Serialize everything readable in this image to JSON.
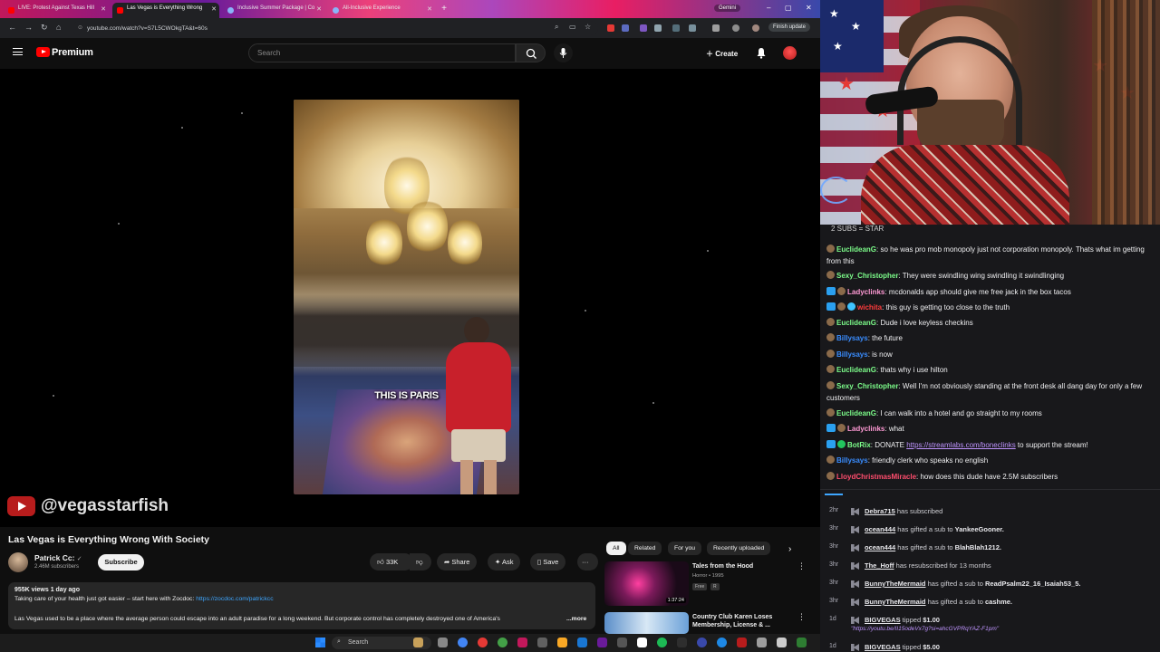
{
  "colors": {
    "yt_red": "#ff0000",
    "link_blue": "#3ea6ff",
    "twitch_purple": "#bf94ff"
  },
  "browser": {
    "tabs": [
      {
        "title": "LIVE: Protest Against Texas Hill",
        "favicon": "youtube-icon"
      },
      {
        "title": "Las Vegas is Everything Wrong",
        "favicon": "youtube-icon",
        "active": true
      },
      {
        "title": "Inclusive Summer Package | Co",
        "favicon": "globe-icon"
      },
      {
        "title": "All-Inclusive Experience",
        "favicon": "globe-icon"
      }
    ],
    "gemini_label": "Gemini",
    "url": "youtube.com/watch?v=S7L5CWOkgTA&t=60s",
    "finish_update": "Finish update"
  },
  "youtube": {
    "logo_text": "Premium",
    "search_placeholder": "Search",
    "create_label": "Create",
    "video": {
      "caption": "THIS IS PARIS",
      "watermark": "@vegasstarfish",
      "title": "Las Vegas is Everything Wrong With Society"
    },
    "channel": {
      "name": "Patrick Cc:",
      "verified": "✓",
      "subscribers": "2.46M subscribers",
      "subscribe_label": "Subscribe"
    },
    "actions": {
      "likes": "33K",
      "share": "Share",
      "ask": "Ask",
      "save": "Save",
      "more": "···"
    },
    "description": {
      "meta": "955K views  1 day ago",
      "sponsor_text": "Taking care of your health just got easier – start here with Zocdoc: ",
      "sponsor_link": "https://zocdoc.com/patrickcc",
      "body": "Las Vegas used to be a place where the average person could escape into an adult paradise for a long weekend. But corporate control has completely destroyed one of America's",
      "more_label": "...more"
    },
    "chips": [
      "All",
      "Related",
      "For you",
      "Recently uploaded"
    ],
    "recommendations": [
      {
        "title": "Tales from the Hood",
        "meta": "Horror • 1995",
        "badges": [
          "Free",
          "R"
        ],
        "duration": "1:37:24"
      },
      {
        "title": "Country Club Karen Loses Membership, License & ...",
        "meta": ""
      }
    ]
  },
  "chat": {
    "header": "2 SUBS = STAR",
    "messages": [
      {
        "user": "EuclideanG",
        "color": "#7CFC8A",
        "text": "so he was pro mob monopoly just not corporation monopoly. Thats what im getting from this",
        "badges": [
          "dot"
        ]
      },
      {
        "user": "Sexy_Christopher",
        "color": "#7CFC8A",
        "text": "They were swindling wing swindling it swindlinging",
        "badges": [
          "dot"
        ]
      },
      {
        "user": "Ladyclinks",
        "color": "#ff9ad5",
        "text": "mcdonalds app should give me free jack in the box tacos",
        "badges": [
          "prime",
          "dot"
        ]
      },
      {
        "user": "wichita",
        "color": "#ff3b3b",
        "text": "this guy is getting too close to the truth",
        "badges": [
          "prime",
          "dot",
          "cube"
        ]
      },
      {
        "user": "EuclideanG",
        "color": "#7CFC8A",
        "text": "Dude i love keyless checkins",
        "badges": [
          "dot"
        ]
      },
      {
        "user": "Billysays",
        "color": "#3a8dff",
        "text": "the future",
        "badges": [
          "dot"
        ]
      },
      {
        "user": "Billysays",
        "color": "#3a8dff",
        "text": "is now",
        "badges": [
          "dot"
        ]
      },
      {
        "user": "EuclideanG",
        "color": "#7CFC8A",
        "text": "thats why i use hilton",
        "badges": [
          "dot"
        ]
      },
      {
        "user": "Sexy_Christopher",
        "color": "#7CFC8A",
        "text": "Well I'm not obviously standing at the front desk all dang day for only a few customers",
        "badges": [
          "dot"
        ]
      },
      {
        "user": "EuclideanG",
        "color": "#7CFC8A",
        "text": "I can walk into a hotel and go straight to my rooms",
        "badges": [
          "dot"
        ]
      },
      {
        "user": "Ladyclinks",
        "color": "#ff9ad5",
        "text": "what",
        "badges": [
          "prime",
          "dot"
        ]
      },
      {
        "user": "BotRix",
        "color": "#7CFC8A",
        "text": "DONATE ",
        "link": "https://streamlabs.com/boneclinks",
        "text_after": " to support the stream!",
        "badges": [
          "prime",
          "bot"
        ]
      },
      {
        "user": "Billysays",
        "color": "#3a8dff",
        "text": "friendly clerk who speaks no english",
        "badges": [
          "dot"
        ]
      },
      {
        "user": "LloydChristmasMiracle",
        "color": "#ff4d6d",
        "text": "how does this dude have 2.5M subscribers",
        "badges": [
          "dot"
        ]
      }
    ]
  },
  "events": [
    {
      "time": "2hr",
      "user": "Debra715",
      "text": " has subscribed"
    },
    {
      "time": "3hr",
      "user": "ocean444",
      "text": " has gifted a sub to ",
      "target": "YankeeGooner."
    },
    {
      "time": "3hr",
      "user": "ocean444",
      "text": " has gifted a sub to ",
      "target": "BlahBlah1212."
    },
    {
      "time": "3hr",
      "user": "The_Hoff",
      "text": " has resubscribed for 13 months"
    },
    {
      "time": "3hr",
      "user": "BunnyTheMermaid",
      "text": " has gifted a sub to ",
      "target": "ReadPsalm22_16_Isaiah53_5."
    },
    {
      "time": "3hr",
      "user": "BunnyTheMermaid",
      "text": " has gifted a sub to ",
      "target": "cashme."
    },
    {
      "time": "1d",
      "user": "BIGVEGAS",
      "text": " tipped ",
      "target": "$1.00",
      "sub": "\"https://youtu.be/II15odeVx7g?si=ahcGVPRqYAZ-F1pm\""
    },
    {
      "time": "1d",
      "user": "BIGVEGAS",
      "text": " tipped ",
      "target": "$5.00"
    }
  ],
  "taskbar": {
    "search_label": "Search"
  }
}
